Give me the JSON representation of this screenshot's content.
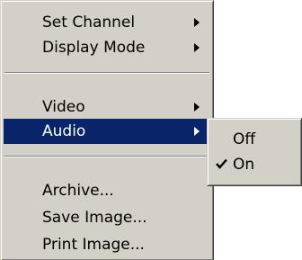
{
  "menu": {
    "items": [
      {
        "label": "Set Channel",
        "has_submenu": true
      },
      {
        "label": "Display Mode",
        "has_submenu": true
      },
      {
        "label": "Video",
        "has_submenu": true
      },
      {
        "label": "Audio",
        "has_submenu": true,
        "selected": true
      },
      {
        "label": "Archive...",
        "has_submenu": false
      },
      {
        "label": "Save Image...",
        "has_submenu": false
      },
      {
        "label": "Print Image...",
        "has_submenu": false
      }
    ]
  },
  "submenu": {
    "items": [
      {
        "label": "Off",
        "checked": false
      },
      {
        "label": "On",
        "checked": true
      }
    ]
  },
  "colors": {
    "menu_face": "#d4d0c8",
    "highlight": "#0a246a",
    "highlight_text": "#ffffff"
  },
  "icons": {
    "submenu_arrow": "chevron-right-icon",
    "check": "checkmark-icon"
  }
}
